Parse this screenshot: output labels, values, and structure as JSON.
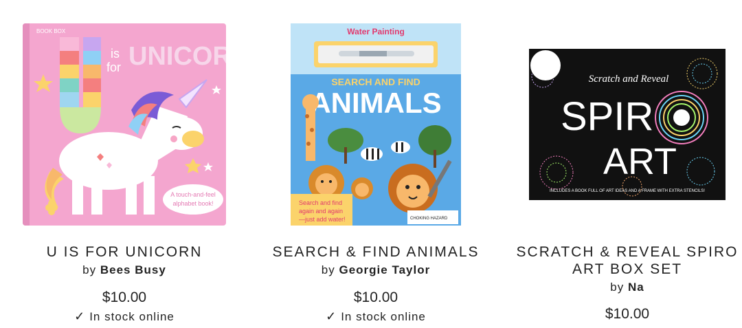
{
  "products": [
    {
      "title": "U IS FOR UNICORN",
      "by": "by",
      "author": "Bees Busy",
      "price": "$10.00",
      "stock": "In stock online",
      "cover": {
        "title_line1": "is",
        "title_line2": "for",
        "title_word": "UNICORN",
        "big_letter": "U",
        "publisher": "BOOK BOX",
        "badge_line1": "A touch-and-feel",
        "badge_line2": "alphabet book!",
        "background": "#f4a6cf"
      }
    },
    {
      "title": "SEARCH & FIND ANIMALS",
      "by": "by",
      "author": "Georgie Taylor",
      "price": "$10.00",
      "stock": "In stock online",
      "cover": {
        "top_label": "Water Painting",
        "subtitle": "SEARCH AND FIND",
        "main_title": "ANIMALS",
        "note_line1": "Search and find",
        "note_line2": "again and again",
        "note_line3": "—just add water!",
        "warning": "CHOKING HAZARD",
        "background": "#5aa9e6"
      }
    },
    {
      "title_line1": "SCRATCH & REVEAL SPIRO",
      "title_line2": "ART BOX SET",
      "by": "by",
      "author": "Na",
      "price": "$10.00",
      "cover": {
        "top_label": "Scratch and Reveal",
        "word1": "SPIR",
        "word2": "ART",
        "footer": "INCLUDES A BOOK FULL OF ART IDEAS AND A FRAME WITH EXTRA STENCILS!",
        "background": "#111111"
      }
    }
  ],
  "icons": {
    "stock": "check-icon"
  },
  "colors": {
    "text": "#222222",
    "pink": "#f4a6cf",
    "sky": "#5aa9e6",
    "black": "#111111"
  }
}
